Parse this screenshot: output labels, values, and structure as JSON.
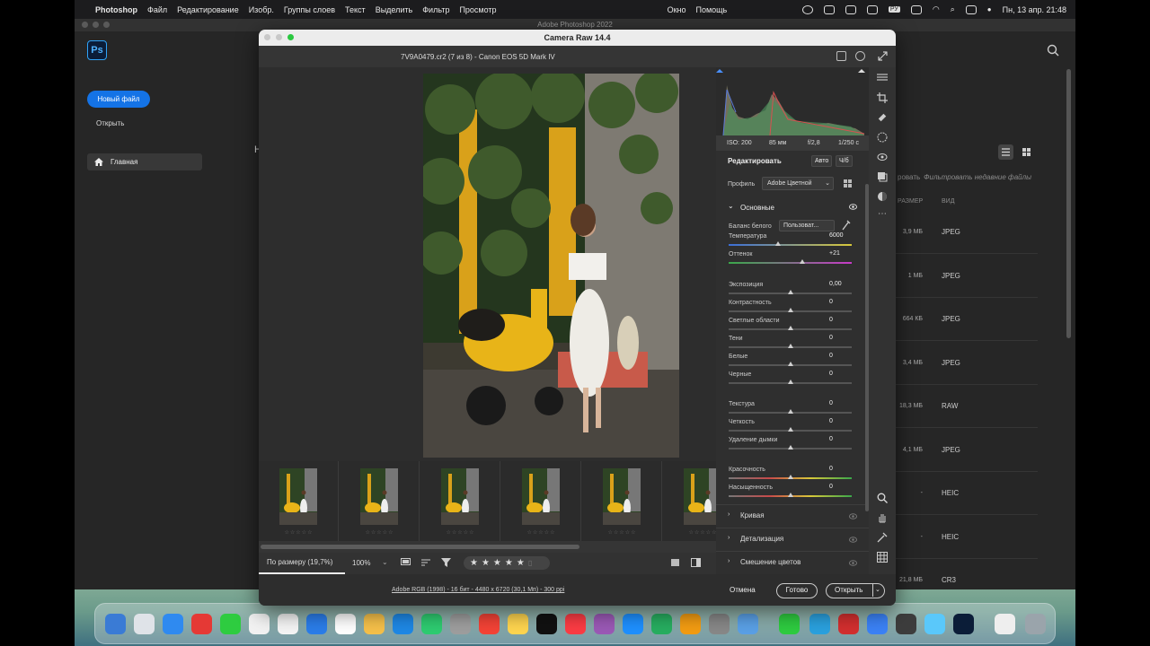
{
  "menubar": {
    "app": "Photoshop",
    "items": [
      "Файл",
      "Редактирование",
      "Изобр.",
      "Группы слоев",
      "Текст",
      "Выделить",
      "Фильтр",
      "Просмотр",
      "Окно",
      "Помощь"
    ],
    "lang": "РУ",
    "clock": "Пн, 13 апр.  21:48"
  },
  "ps": {
    "window_title": "Adobe Photoshop 2022",
    "logo": "Ps",
    "new_file": "Новый файл",
    "open": "Открыть",
    "home": "Главная",
    "home_letter": "Н",
    "filter_label": "ровать",
    "filter_placeholder": "Фильтровать недавние файлы",
    "col_size": "РАЗМЕР",
    "col_kind": "ВИД",
    "files": [
      {
        "size": "3,9 МБ",
        "kind": "JPEG"
      },
      {
        "size": "1 МБ",
        "kind": "JPEG"
      },
      {
        "size": "664 КБ",
        "kind": "JPEG"
      },
      {
        "size": "3,4 МБ",
        "kind": "JPEG"
      },
      {
        "size": "18,3 МБ",
        "kind": "RAW"
      },
      {
        "size": "4,1 МБ",
        "kind": "JPEG"
      },
      {
        "size": "-",
        "kind": "HEIC"
      },
      {
        "size": "-",
        "kind": "HEIC"
      },
      {
        "size": "21,8 МБ",
        "kind": "CR3"
      }
    ]
  },
  "cr": {
    "title": "Camera Raw 14.4",
    "filename": "7V9A0479.cr2 (7 из 8)  -  Canon EOS 5D Mark IV",
    "exif": {
      "iso": "ISO: 200",
      "focal": "85 мм",
      "aperture": "f/2,8",
      "shutter": "1/250 с"
    },
    "edit_title": "Редактировать",
    "auto": "Авто",
    "bw": "Ч/б",
    "profile_label": "Профиль",
    "profile_value": "Adobe Цветной",
    "basic_title": "Основные",
    "wb_label": "Баланс белого",
    "wb_value": "Пользоват...",
    "sliders": [
      {
        "label": "Температура",
        "value": "6000",
        "pos": 0.4
      },
      {
        "label": "Оттенок",
        "value": "+21",
        "pos": 0.6
      },
      {
        "label": "Экспозиция",
        "value": "0,00",
        "pos": 0.5
      },
      {
        "label": "Контрастность",
        "value": "0",
        "pos": 0.5
      },
      {
        "label": "Светлые области",
        "value": "0",
        "pos": 0.5
      },
      {
        "label": "Тени",
        "value": "0",
        "pos": 0.5
      },
      {
        "label": "Белые",
        "value": "0",
        "pos": 0.5
      },
      {
        "label": "Черные",
        "value": "0",
        "pos": 0.5
      },
      {
        "label": "Текстура",
        "value": "0",
        "pos": 0.5
      },
      {
        "label": "Четкость",
        "value": "0",
        "pos": 0.5
      },
      {
        "label": "Удаление дымки",
        "value": "0",
        "pos": 0.5
      },
      {
        "label": "Красочность",
        "value": "0",
        "pos": 0.5
      },
      {
        "label": "Насыщенность",
        "value": "0",
        "pos": 0.5
      }
    ],
    "sections": [
      "Кривая",
      "Детализация",
      "Смешение цветов"
    ],
    "zoom_fit": "По размеру (19,7%)",
    "zoom_pct": "100%",
    "stars": "★★★★★",
    "thumb_stars": "☆☆☆☆☆",
    "footer_info": "Adobe RGB (1998) - 16 бит - 4480 x 6720 (30,1 Мп) - 300 ppi",
    "cancel": "Отмена",
    "done": "Готово",
    "open": "Открыть"
  },
  "colors": {
    "accent": "#1473e6",
    "panel": "#2f2f2f"
  }
}
